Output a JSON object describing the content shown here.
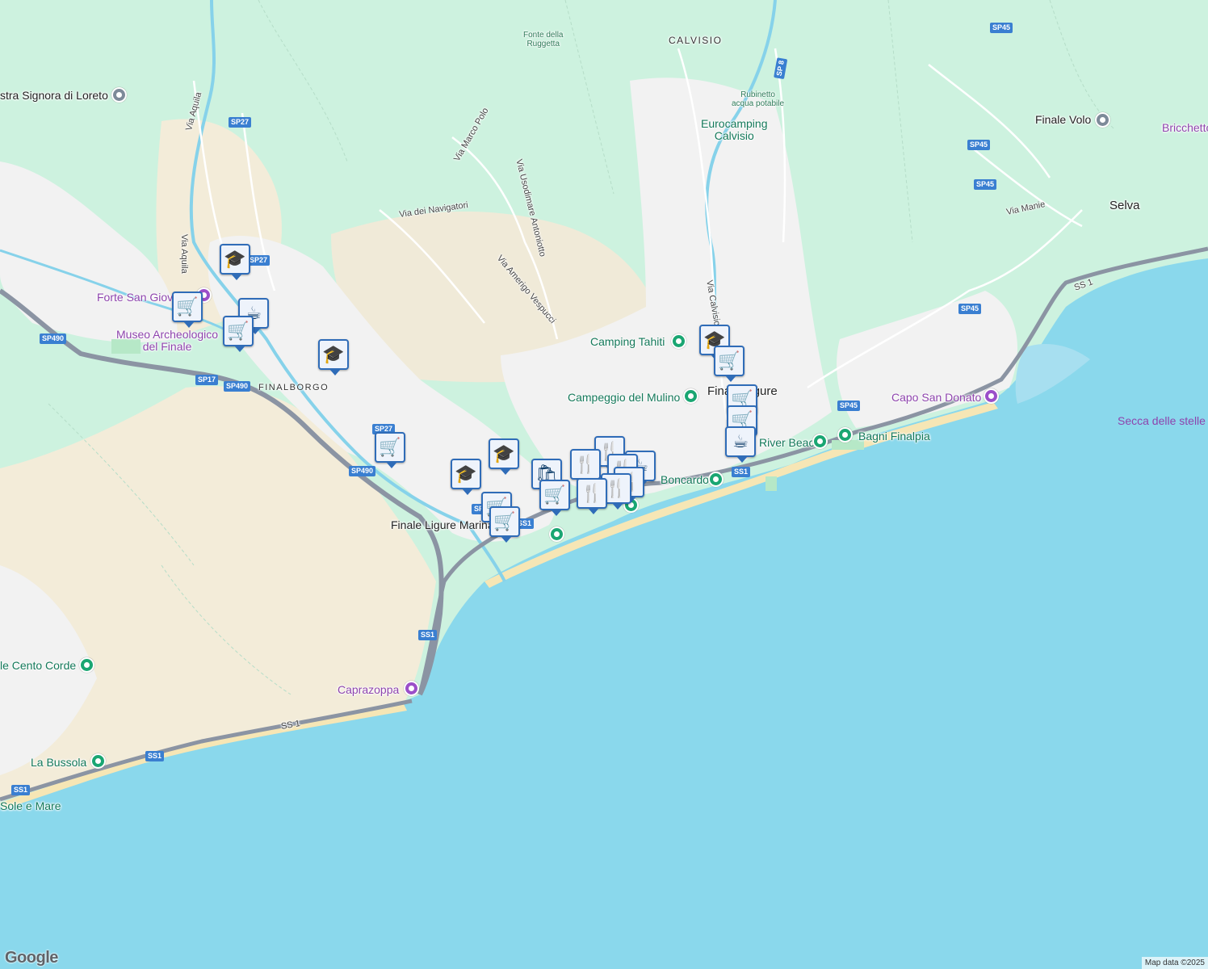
{
  "map": {
    "attribution": "Map data ©2025",
    "logo": "Google",
    "colors": {
      "sea": "#8ad8ec",
      "forest": "#cdf2df",
      "urban": "#f2f2f2",
      "sand": "#f3ecd9",
      "highway": "#8b94a3",
      "road_shield": "#3a7fd1"
    }
  },
  "labels": {
    "calvisio": "CALVISIO",
    "fonte": "Fonte della\nRuggetta",
    "rubinetto": "Rubinetto\nacqua potabile",
    "eurocamping": "Eurocamping\nCalvisio",
    "finale_volo": "Finale Volo",
    "bricchetto": "Bricchetto",
    "selva": "Selva",
    "via_manie": "Via Manie",
    "signora": "stra Signora di Loreto",
    "via_aquila_1": "Via Aquila",
    "via_aquila_2": "Via Aquila",
    "via_marco_polo": "Via Marco Polo",
    "via_usodimare": "Via Usodimare Antoniotto",
    "via_navigatori": "Via dei Navigatori",
    "via_vespucci": "Via Amerigo Vespucci",
    "via_calvisio": "Via Calvisio",
    "forte": "Forte San Giovanni",
    "museo": "Museo Archeologico\ndel Finale",
    "finalborgo": "FINALBORGO",
    "camping_tahiti": "Camping Tahiti",
    "campeggio_mulino": "Campeggio del Mulino",
    "finale_ligure": "Finale Ligure",
    "capo_san_donato": "Capo San Donato",
    "secca": "Secca delle stelle",
    "river_beach": "River Beach",
    "bagni_finalpia": "Bagni Finalpia",
    "boncardo": "Boncardo",
    "finale_marina": "Finale Ligure Marina",
    "cento_corde": "le Cento Corde",
    "caprazoppa": "Caprazoppa",
    "la_bussola": "La Bussola",
    "sole_e_mare": "Sole e Mare"
  },
  "shields": {
    "sp45_a": "SP45",
    "sp45_b": "SP45",
    "sp45_c": "SP45",
    "sp45_d": "SP45",
    "sp45_e": "SP45",
    "sp8": "SP 8",
    "sp27_a": "SP27",
    "sp27_b": "SP27",
    "sp27_c": "SP27",
    "sp490_a": "SP490",
    "sp490_b": "SP490",
    "sp490_c": "SP490",
    "sp17": "SP17",
    "ss1_a": "SS1",
    "ss1_b": "SS1",
    "ss1_c": "SS1",
    "ss1_d": "SS1",
    "ss1_e": "SS1",
    "ss1_f": "SS1",
    "sp_x": "SP"
  },
  "road_labels": {
    "ss1_curve": "SS 1",
    "ss1_right": "SS 1"
  },
  "icons": {
    "school": "🎓",
    "cart": "🛒",
    "cup": "☕",
    "fork": "🍴",
    "bag": "🛍"
  }
}
